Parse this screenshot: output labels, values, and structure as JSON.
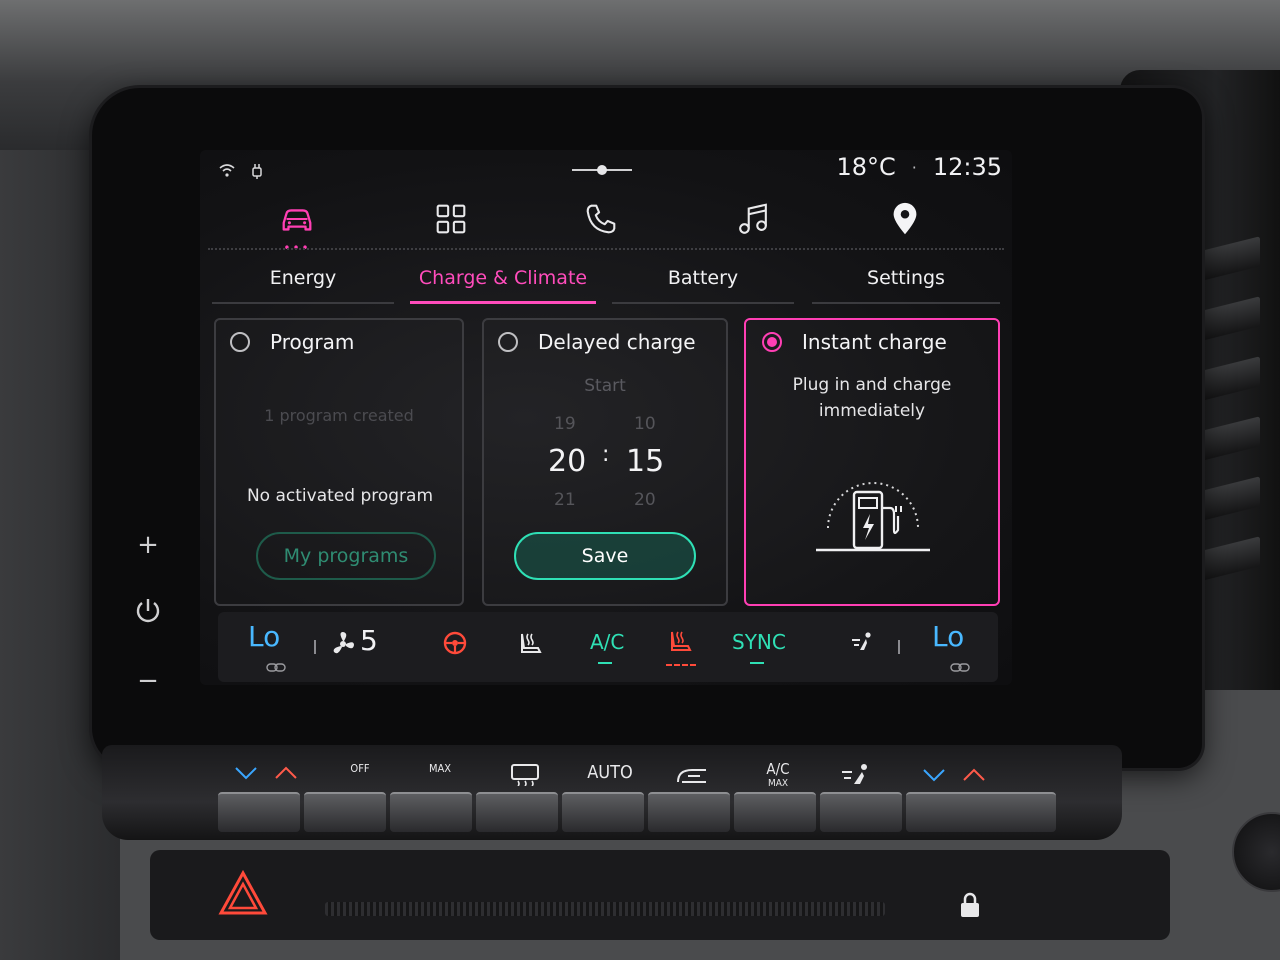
{
  "status": {
    "temperature": "18°C",
    "separator": "·",
    "time": "12:35"
  },
  "appbar": {
    "icons": [
      "car-icon",
      "apps-grid-icon",
      "phone-icon",
      "music-icon",
      "location-pin-icon"
    ]
  },
  "tabs": [
    {
      "label": "Energy"
    },
    {
      "label": "Charge & Climate"
    },
    {
      "label": "Battery"
    },
    {
      "label": "Settings"
    }
  ],
  "cards": {
    "program": {
      "title": "Program",
      "faint_text": "1 program created",
      "status": "No activated program",
      "button": "My programs"
    },
    "delayed": {
      "title": "Delayed charge",
      "start_label": "Start",
      "hour_prev": "19",
      "hour": "20",
      "hour_next": "21",
      "colon": ":",
      "minute_prev": "10",
      "minute": "15",
      "minute_next": "20",
      "button": "Save"
    },
    "instant": {
      "title": "Instant charge",
      "description": "Plug in and charge immediately"
    }
  },
  "climate": {
    "left_temp": "Lo",
    "fan_speed": "5",
    "ac": "A/C",
    "sync": "SYNC",
    "right_temp": "Lo"
  },
  "physical": {
    "auto": "AUTO",
    "ac_max": "A/C",
    "ac_max_sub": "MAX",
    "off": "OFF",
    "max": "MAX"
  },
  "colors": {
    "accent_pink": "#ff3fb4",
    "teal": "#2fe0b5",
    "temp_blue": "#49b8ff",
    "heat_red": "#ff4a3a"
  }
}
